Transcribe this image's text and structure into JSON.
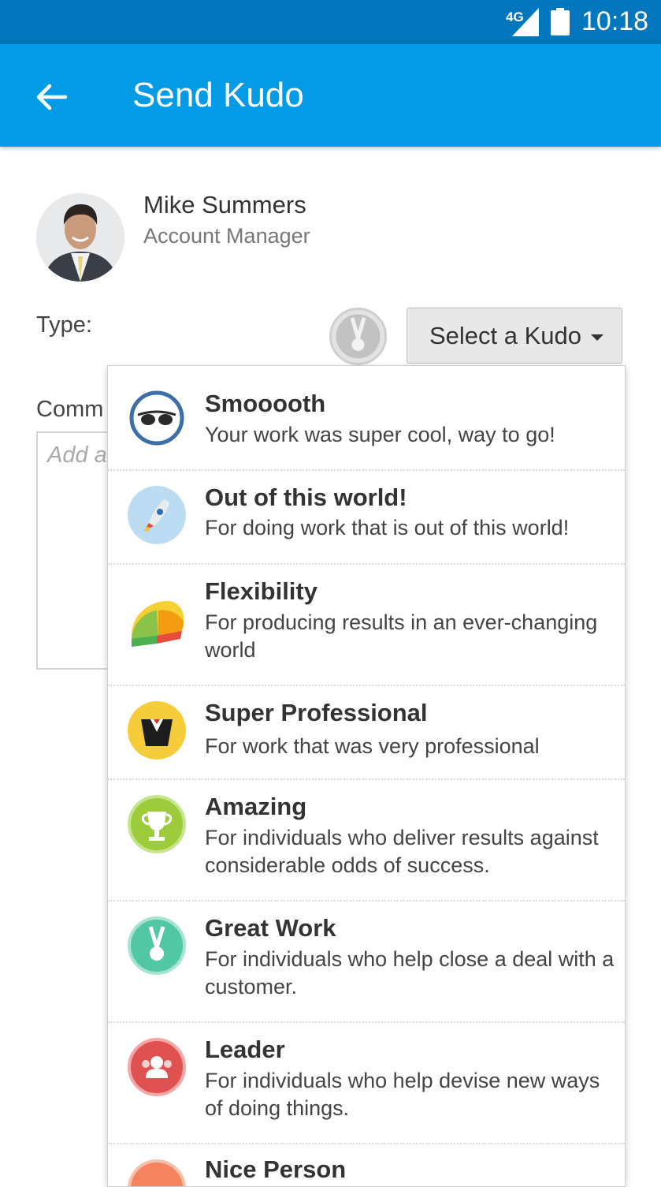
{
  "status_bar": {
    "network": "4G",
    "time": "10:18"
  },
  "app_bar": {
    "title": "Send Kudo",
    "back_icon": "arrow-left-icon"
  },
  "recipient": {
    "name": "Mike Summers",
    "role": "Account Manager"
  },
  "form": {
    "type_label": "Type:",
    "select_label": "Select a Kudo",
    "comment_label": "Comm",
    "comment_placeholder": "Add a"
  },
  "kudos": [
    {
      "name": "Smooooth",
      "desc": "Your work was super cool, way to go!",
      "icon": "sunglasses-icon"
    },
    {
      "name": "Out of this world!",
      "desc": "For doing work that is out of this world!",
      "icon": "rocket-icon"
    },
    {
      "name": "Flexibility",
      "desc": "For producing results in an ever-changing world",
      "icon": "slinky-icon"
    },
    {
      "name": "Super Professional",
      "desc": "For work that was very professional",
      "icon": "tuxedo-icon"
    },
    {
      "name": "Amazing",
      "desc": "For individuals who deliver results against considerable odds of success.",
      "icon": "trophy-icon"
    },
    {
      "name": "Great Work",
      "desc": "For individuals who help close a deal with a customer.",
      "icon": "medal-icon"
    },
    {
      "name": "Leader",
      "desc": "For individuals who help devise new ways of doing things.",
      "icon": "leader-icon"
    },
    {
      "name": "Nice Person",
      "desc": "",
      "icon": "smile-icon"
    }
  ],
  "colors": {
    "status_bar": "#0277bd",
    "app_bar": "#039be5"
  }
}
